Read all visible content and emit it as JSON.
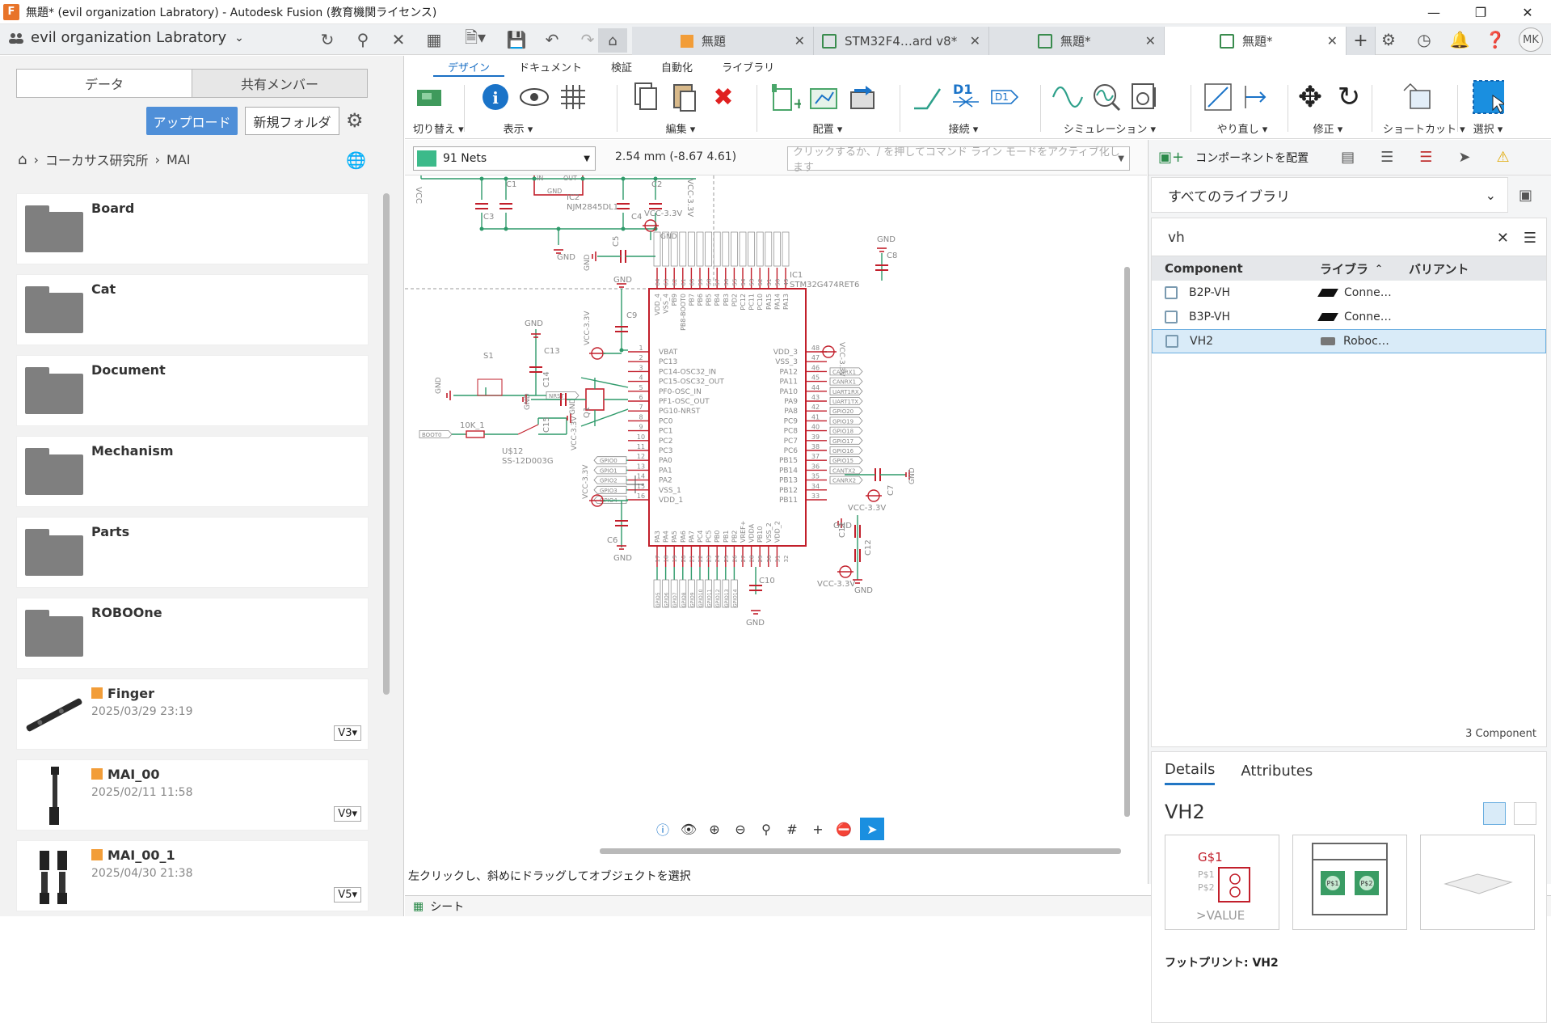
{
  "window": {
    "title": "無題* (evil organization Labratory) - Autodesk Fusion (教育機関ライセンス)",
    "app_icon": "F"
  },
  "topbar": {
    "team": "evil organization Labratory",
    "avatar": "MK"
  },
  "tabs": [
    {
      "label": "無題",
      "icon": "cube-icon"
    },
    {
      "label": "STM32F4…ard v8*",
      "icon": "board-icon"
    },
    {
      "label": "無題*",
      "icon": "board-icon"
    },
    {
      "label": "無題*",
      "icon": "schematic-icon",
      "active": true
    }
  ],
  "left": {
    "seg_data": "データ",
    "seg_members": "共有メンバー",
    "upload": "アップロード",
    "new_folder": "新規フォルダ",
    "breadcrumb": [
      "コーカサス研究所",
      "MAI"
    ],
    "items": [
      {
        "name": "Board",
        "type": "folder"
      },
      {
        "name": "Cat",
        "type": "folder"
      },
      {
        "name": "Document",
        "type": "folder"
      },
      {
        "name": "Mechanism",
        "type": "folder"
      },
      {
        "name": "Parts",
        "type": "folder"
      },
      {
        "name": "ROBOOne",
        "type": "folder"
      },
      {
        "name": "Finger",
        "type": "design",
        "date": "2025/03/29 23:19",
        "version": "V3"
      },
      {
        "name": "MAI_00",
        "type": "design",
        "date": "2025/02/11 11:58",
        "version": "V9"
      },
      {
        "name": "MAI_00_1",
        "type": "design",
        "date": "2025/04/30 21:38",
        "version": "V5"
      }
    ]
  },
  "ribbon": {
    "tabs": [
      "デザイン",
      "ドキュメント",
      "検証",
      "自動化",
      "ライブラリ"
    ],
    "active_tab": "デザイン",
    "groups": [
      {
        "label": "切り替え"
      },
      {
        "label": "表示"
      },
      {
        "label": "編集"
      },
      {
        "label": "配置"
      },
      {
        "label": "接続"
      },
      {
        "label": "シミュレーション"
      },
      {
        "label": "やり直し"
      },
      {
        "label": "修正"
      },
      {
        "label": "ショートカット"
      },
      {
        "label": "選択"
      }
    ]
  },
  "optbar": {
    "net_select": "91 Nets",
    "coord": "2.54 mm (-8.67 4.61)",
    "cmd_placeholder": "クリックするか、/ を押してコマンド ライン モードをアクティブ化します",
    "net_color": "#3cba8a"
  },
  "status": {
    "hint": "左クリックし、斜めにドラッグしてオブジェクトを選択",
    "sheet": "シート"
  },
  "right": {
    "place_component": "コンポーネントを配置",
    "library": "すべてのライブラリ",
    "search_value": "vh",
    "columns": [
      "Component",
      "ライブラ",
      "バリアント"
    ],
    "rows": [
      {
        "component": "B2P-VH",
        "library": "Conne…",
        "selected": false
      },
      {
        "component": "B3P-VH",
        "library": "Conne…",
        "selected": false
      },
      {
        "component": "VH2",
        "library": "Roboc…",
        "selected": true
      }
    ],
    "count": "3 Component",
    "details_tab": "Details",
    "attributes_tab": "Attributes",
    "detail_name": "VH2",
    "footprint": "フットプリント: VH2",
    "preview_symbol": [
      "G$1",
      "P$1",
      "P$2",
      ">VALUE"
    ],
    "preview_pads": [
      "P$1",
      "P$2"
    ]
  },
  "schematic": {
    "mcu_name": "IC1",
    "mcu_value": "STM32G474RET6",
    "left_pins": [
      {
        "num": "1",
        "name": "VBAT"
      },
      {
        "num": "2",
        "name": "PC13"
      },
      {
        "num": "3",
        "name": "PC14-OSC32_IN"
      },
      {
        "num": "4",
        "name": "PC15-OSC32_OUT"
      },
      {
        "num": "5",
        "name": "PF0-OSC_IN"
      },
      {
        "num": "6",
        "name": "PF1-OSC_OUT"
      },
      {
        "num": "7",
        "name": "PG10-NRST"
      },
      {
        "num": "8",
        "name": "PC0"
      },
      {
        "num": "9",
        "name": "PC1"
      },
      {
        "num": "10",
        "name": "PC2"
      },
      {
        "num": "11",
        "name": "PC3"
      },
      {
        "num": "12",
        "name": "PA0"
      },
      {
        "num": "13",
        "name": "PA1"
      },
      {
        "num": "14",
        "name": "PA2"
      },
      {
        "num": "15",
        "name": "VSS_1"
      },
      {
        "num": "16",
        "name": "VDD_1"
      }
    ],
    "right_pins": [
      {
        "num": "48",
        "name": "VDD_3"
      },
      {
        "num": "47",
        "name": "VSS_3"
      },
      {
        "num": "46",
        "name": "PA12"
      },
      {
        "num": "45",
        "name": "PA11"
      },
      {
        "num": "44",
        "name": "PA10"
      },
      {
        "num": "43",
        "name": "PA9"
      },
      {
        "num": "42",
        "name": "PA8"
      },
      {
        "num": "41",
        "name": "PC9"
      },
      {
        "num": "40",
        "name": "PC8"
      },
      {
        "num": "39",
        "name": "PC7"
      },
      {
        "num": "38",
        "name": "PC6"
      },
      {
        "num": "37",
        "name": "PB15"
      },
      {
        "num": "36",
        "name": "PB14"
      },
      {
        "num": "35",
        "name": "PB13"
      },
      {
        "num": "34",
        "name": "PB12"
      },
      {
        "num": "33",
        "name": "PB11"
      }
    ],
    "top_pins": [
      "VDD_4",
      "VSS_4",
      "PB9",
      "PB8-BOOT0",
      "PB7",
      "PB6",
      "PB5",
      "PB4",
      "PB3",
      "PD2",
      "PC12",
      "PC11",
      "PC10",
      "PA15",
      "PA14",
      "PA13"
    ],
    "top_nums": [
      "64",
      "63",
      "62",
      "61",
      "60",
      "59",
      "58",
      "57",
      "56",
      "55",
      "54",
      "53",
      "52",
      "51",
      "50",
      "49"
    ],
    "bottom_pins": [
      "PA3",
      "PA4",
      "PA5",
      "PA6",
      "PA7",
      "PC4",
      "PC5",
      "PB0",
      "PB1",
      "PB2",
      "VREF+",
      "VDDA",
      "PB10",
      "VSS_2",
      "VDD_2"
    ],
    "bottom_nums": [
      "17",
      "18",
      "19",
      "20",
      "21",
      "22",
      "23",
      "24",
      "25",
      "26",
      "27",
      "28",
      "29",
      "30",
      "31",
      "32"
    ],
    "right_tags": [
      "CANRX1",
      "CANRX1",
      "UART1RX",
      "UART1TX",
      "GPIO20",
      "GPIO19",
      "GPIO18",
      "GPIO17",
      "GPIO16",
      "GPIO15",
      "CANTX2",
      "CANRX2"
    ],
    "left_tags": [
      "GPIO0",
      "GPIO1",
      "GPIO2",
      "GPIO3",
      "GPIO4"
    ],
    "bottom_tags": [
      "GPIO5",
      "GPIO6",
      "GPIO7",
      "GPIO8",
      "GPIO9",
      "GPIO10",
      "GPIO11",
      "GPIO12",
      "GPIO13",
      "GPIO14"
    ],
    "labels": {
      "vcc33": "VCC-3.3V",
      "gnd": "GND",
      "vcc": "VCC",
      "c1": "C1",
      "c2": "C2",
      "c3": "C3",
      "c4": "C4",
      "c5": "C5",
      "c6": "C6",
      "c7": "C7",
      "c8": "C8",
      "c9": "C9",
      "c10": "C10",
      "c11": "C11",
      "c12": "C12",
      "c13": "C13",
      "c14": "C14",
      "c15": "C15",
      "ic2": "IC2",
      "njm": "NJM2845DL1",
      "in": "IN",
      "out": "OUT",
      "s1": "S1",
      "r": "10K_1",
      "u12": "U$12",
      "ss": "SS-12D003G",
      "nrst": "NRST",
      "boot0": "BOOT0",
      "q1": "Q1"
    },
    "wire_color": "#2e9a6a",
    "part_color": "#c21f2b"
  }
}
